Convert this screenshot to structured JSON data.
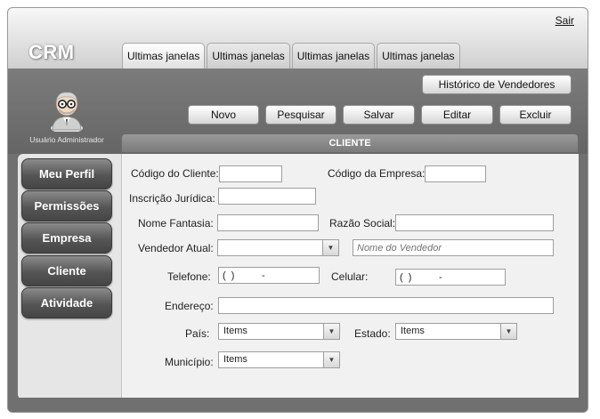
{
  "header": {
    "brand": "CRM",
    "logout": "Sair",
    "tabs": [
      "Ultimas janelas",
      "Ultimas janelas",
      "Ultimas janelas",
      "Ultimas janelas"
    ]
  },
  "user": {
    "label": "Usuário Administrador",
    "avatar_icon": "admin-user-avatar-icon"
  },
  "toolbar": {
    "history": "Histórico de Vendedores",
    "novo": "Novo",
    "pesquisar": "Pesquisar",
    "salvar": "Salvar",
    "editar": "Editar",
    "excluir": "Excluir"
  },
  "sidebar": {
    "items": [
      {
        "label": "Meu Perfil"
      },
      {
        "label": "Permissões"
      },
      {
        "label": "Empresa"
      },
      {
        "label": "Cliente"
      },
      {
        "label": "Atividade"
      }
    ]
  },
  "section": {
    "title": "CLIENTE"
  },
  "form": {
    "codigo_cliente": {
      "label": "Código do Cliente:",
      "value": ""
    },
    "codigo_empresa": {
      "label": "Código da Empresa:",
      "value": ""
    },
    "inscricao": {
      "label": "Inscrição Jurídica:",
      "value": ""
    },
    "nome_fantasia": {
      "label": "Nome Fantasia:",
      "value": ""
    },
    "razao_social": {
      "label": "Razão Social:",
      "value": ""
    },
    "vendedor": {
      "label": "Vendedor Atual:",
      "selected": "",
      "name_placeholder": "Nome do Vendedor"
    },
    "telefone": {
      "label": "Telefone:",
      "mask": "(  )          -"
    },
    "celular": {
      "label": "Celular:",
      "mask": "(  )          -"
    },
    "endereco": {
      "label": "Endereço:",
      "value": ""
    },
    "pais": {
      "label": "País:",
      "selected": "Items"
    },
    "estado": {
      "label": "Estado:",
      "selected": "Items"
    },
    "municipio": {
      "label": "Município:",
      "selected": "Items"
    }
  },
  "colors": {
    "background": "#707070",
    "panel": "#f1f1f1",
    "sidebar_button": "#555555"
  }
}
